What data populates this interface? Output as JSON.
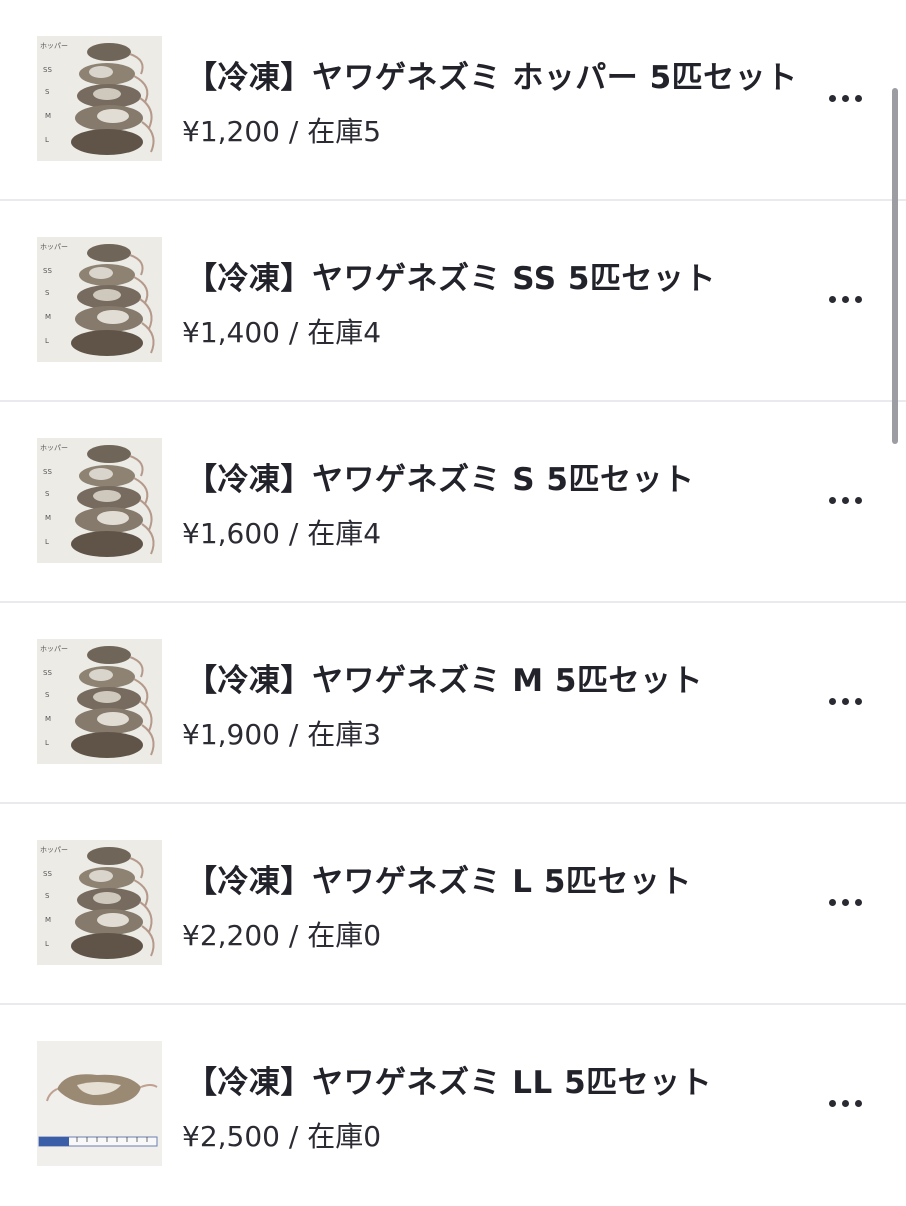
{
  "products": [
    {
      "title": "【冷凍】ヤワゲネズミ ホッパー 5匹セット",
      "price_stock": "¥1,200 / 在庫5",
      "image": "mice-size-comparison",
      "image_labels": [
        "ホッパー",
        "SS",
        "S",
        "M",
        "L"
      ]
    },
    {
      "title": "【冷凍】ヤワゲネズミ SS 5匹セット",
      "price_stock": "¥1,400 / 在庫4",
      "image": "mice-size-comparison",
      "image_labels": [
        "ホッパー",
        "SS",
        "S",
        "M",
        "L"
      ]
    },
    {
      "title": "【冷凍】ヤワゲネズミ S 5匹セット",
      "price_stock": "¥1,600 / 在庫4",
      "image": "mice-size-comparison",
      "image_labels": [
        "ホッパー",
        "SS",
        "S",
        "M",
        "L"
      ]
    },
    {
      "title": "【冷凍】ヤワゲネズミ M 5匹セット",
      "price_stock": "¥1,900 / 在庫3",
      "image": "mice-size-comparison",
      "image_labels": [
        "ホッパー",
        "SS",
        "S",
        "M",
        "L"
      ]
    },
    {
      "title": "【冷凍】ヤワゲネズミ L 5匹セット",
      "price_stock": "¥2,200 / 在庫0",
      "image": "mice-size-comparison",
      "image_labels": [
        "ホッパー",
        "SS",
        "S",
        "M",
        "L"
      ]
    },
    {
      "title": "【冷凍】ヤワゲネズミ LL 5匹セット",
      "price_stock": "¥2,500 / 在庫0",
      "image": "single-mouse-with-ruler",
      "image_labels": []
    }
  ],
  "more_icon": "ellipsis-horizontal-icon",
  "colors": {
    "text": "#22222a",
    "divider": "#e9e9ee",
    "scrollbar": "#9c9ca3"
  }
}
